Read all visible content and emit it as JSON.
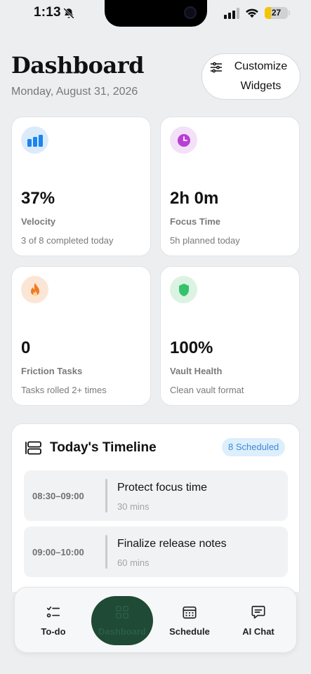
{
  "status_bar": {
    "time": "1:13",
    "battery": "27",
    "battery_level": 0.27
  },
  "header": {
    "title": "Dashboard",
    "date": "Monday, August 31, 2026",
    "customize_label": "Customize Widgets"
  },
  "metrics": [
    {
      "value": "37%",
      "label": "Velocity",
      "sub": "3 of 8 completed today",
      "icon": "bar-chart-icon",
      "color": "#1a84f0",
      "bg": "#dcebfb"
    },
    {
      "value": "2h 0m",
      "label": "Focus Time",
      "sub": "5h planned today",
      "icon": "clock-icon",
      "color": "#b83fd6",
      "bg": "#f3e1f8"
    },
    {
      "value": "0",
      "label": "Friction Tasks",
      "sub": "Tasks rolled 2+ times",
      "icon": "flame-icon",
      "color": "#f07a22",
      "bg": "#fbe6d6"
    },
    {
      "value": "100%",
      "label": "Vault Health",
      "sub": "Clean vault format",
      "icon": "shield-icon",
      "color": "#34c36a",
      "bg": "#dcf3e3"
    }
  ],
  "timeline": {
    "title": "Today's Timeline",
    "badge": "8 Scheduled",
    "items": [
      {
        "time": "08:30–09:00",
        "title": "Protect focus time",
        "duration": "30 mins"
      },
      {
        "time": "09:00–10:00",
        "title": "Finalize release notes",
        "duration": "60 mins"
      }
    ]
  },
  "nav": {
    "items": [
      {
        "label": "To-do",
        "icon": "checklist-icon"
      },
      {
        "label": "Dashboard",
        "icon": "grid-icon",
        "active": true
      },
      {
        "label": "Schedule",
        "icon": "calendar-icon"
      },
      {
        "label": "AI Chat",
        "icon": "chat-icon"
      }
    ]
  }
}
